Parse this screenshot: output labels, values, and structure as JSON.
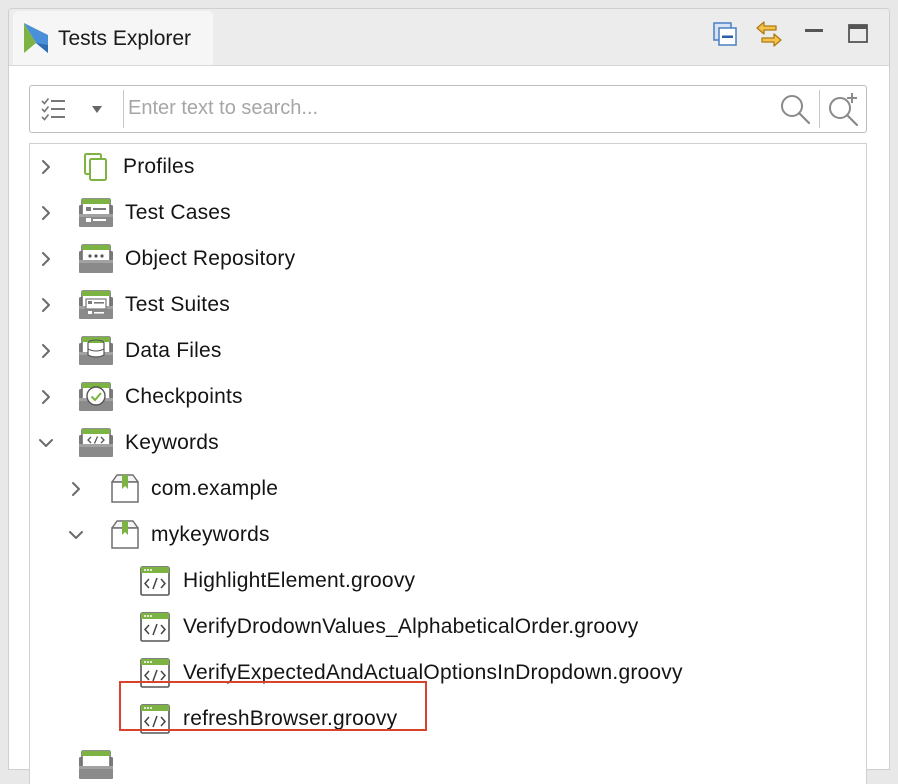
{
  "tab": {
    "title": "Tests Explorer",
    "icon": "katalon-logo-icon"
  },
  "toolbar": {
    "collapse_all_icon": "collapse-all-icon",
    "link_editor_icon": "link-with-editor-icon",
    "minimize_icon": "minimize-icon",
    "maximize_icon": "maximize-icon"
  },
  "search": {
    "placeholder": "Enter text to search...",
    "value": "",
    "filter_icon": "checklist-filter-icon",
    "dropdown_icon": "chevron-down-icon",
    "search_icon": "search-icon",
    "advanced_icon": "advanced-search-icon"
  },
  "tree": {
    "profiles": {
      "label": "Profiles",
      "expanded": false,
      "icon": "profiles-icon"
    },
    "test_cases": {
      "label": "Test Cases",
      "expanded": false,
      "icon": "test-cases-folder-icon"
    },
    "object_repository": {
      "label": "Object Repository",
      "expanded": false,
      "icon": "object-repository-folder-icon"
    },
    "test_suites": {
      "label": "Test Suites",
      "expanded": false,
      "icon": "test-suites-folder-icon"
    },
    "data_files": {
      "label": "Data Files",
      "expanded": false,
      "icon": "data-files-folder-icon"
    },
    "checkpoints": {
      "label": "Checkpoints",
      "expanded": false,
      "icon": "checkpoints-folder-icon"
    },
    "keywords": {
      "label": "Keywords",
      "expanded": true,
      "icon": "keywords-folder-icon",
      "packages": [
        {
          "label": "com.example",
          "expanded": false,
          "icon": "package-icon"
        },
        {
          "label": "mykeywords",
          "expanded": true,
          "icon": "package-icon",
          "files": [
            {
              "label": "HighlightElement.groovy",
              "icon": "groovy-file-icon"
            },
            {
              "label": "VerifyDrodownValues_AlphabeticalOrder.groovy",
              "icon": "groovy-file-icon"
            },
            {
              "label": "VerifyExpectedAndActualOptionsInDropdown.groovy",
              "icon": "groovy-file-icon"
            },
            {
              "label": "refreshBrowser.groovy",
              "icon": "groovy-file-icon",
              "highlighted": true
            }
          ]
        }
      ]
    }
  },
  "colors": {
    "accent_green": "#7cb342",
    "folder_gray": "#6f6f6f",
    "highlight_border": "#d9422e",
    "link_orange": "#e8a21a",
    "collapse_blue": "#4a7fc1"
  }
}
